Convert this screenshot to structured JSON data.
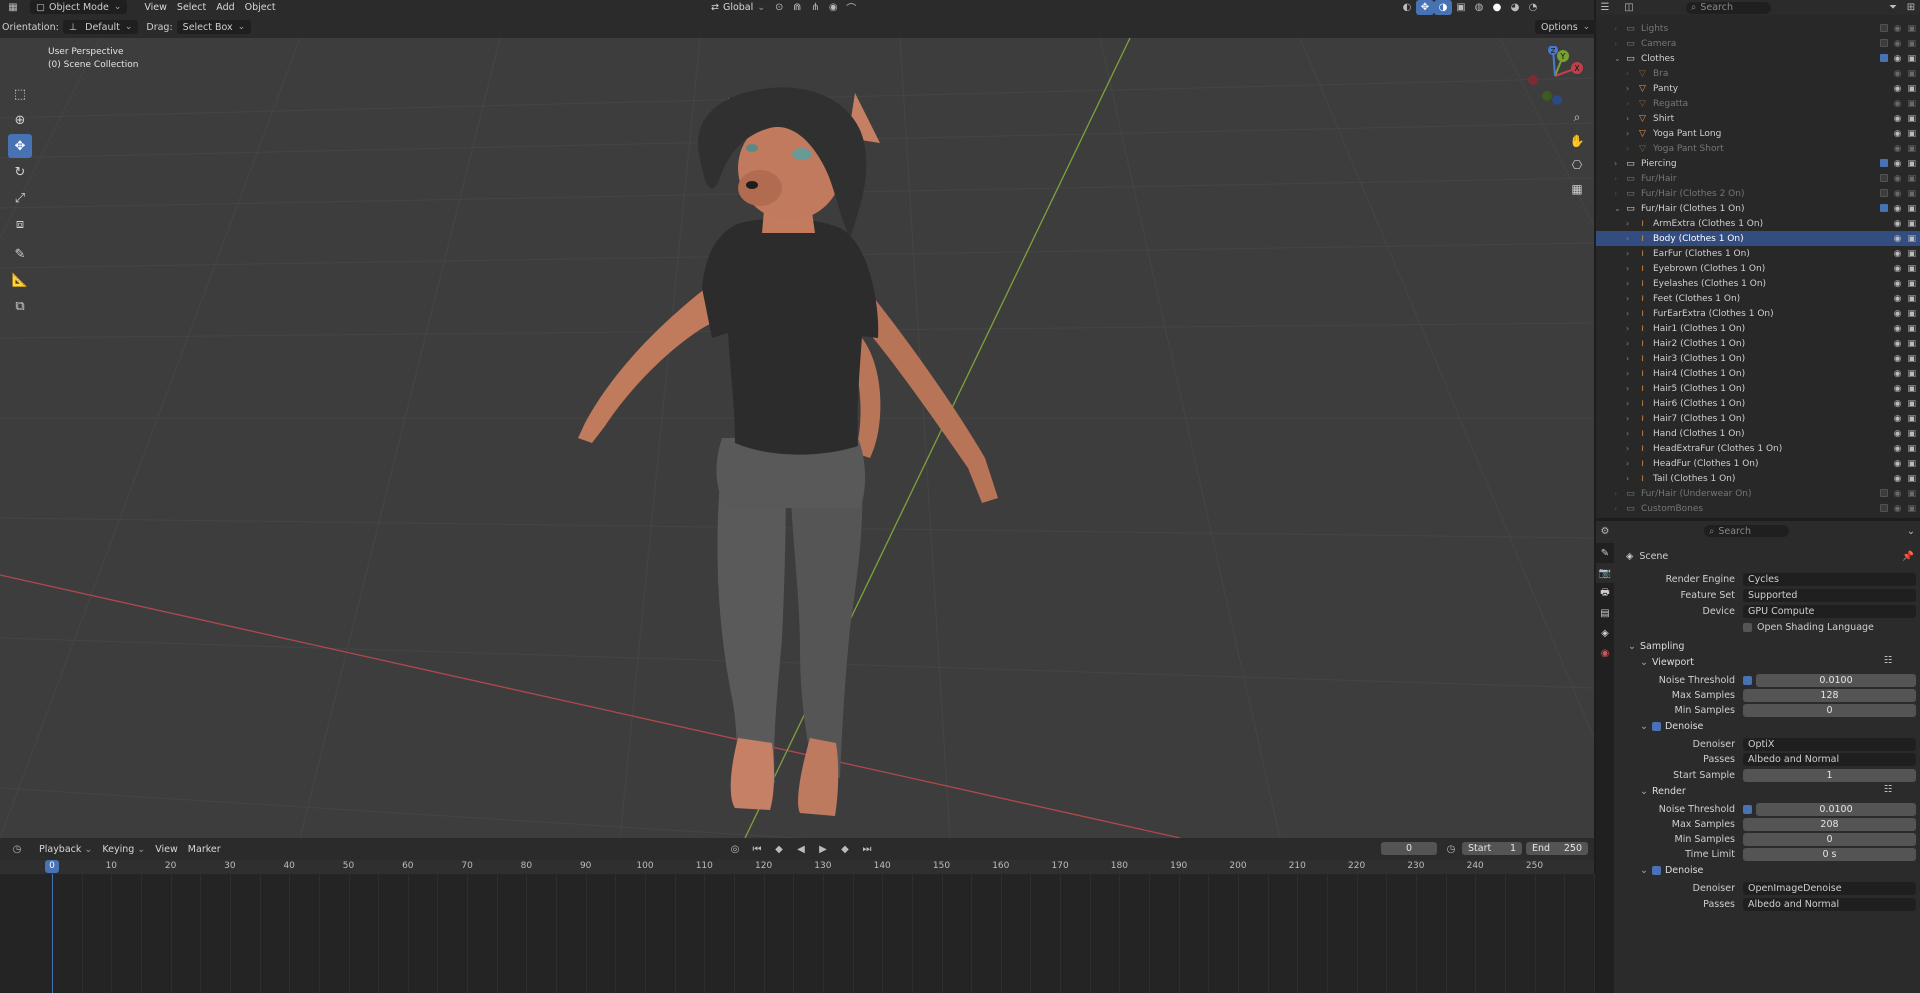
{
  "header": {
    "mode": "Object Mode",
    "menu": [
      "View",
      "Select",
      "Add",
      "Object"
    ],
    "transform_orientation": "Global",
    "orientation_label": "Orientation:",
    "orientation_value": "Default",
    "drag_label": "Drag:",
    "drag_value": "Select Box",
    "options_label": "Options",
    "search_placeholder": "Search"
  },
  "viewport": {
    "view_name": "User Perspective",
    "collection_info": "(0) Scene Collection",
    "gizmo": {
      "x": "X",
      "y": "Y",
      "z": "Z"
    }
  },
  "timeline": {
    "menu": [
      "Playback",
      "Keying",
      "View",
      "Marker"
    ],
    "current_frame": "0",
    "start_label": "Start",
    "start": "1",
    "end_label": "End",
    "end": "250",
    "playhead": "0",
    "ticks": [
      "10",
      "20",
      "30",
      "40",
      "50",
      "60",
      "70",
      "80",
      "90",
      "100",
      "110",
      "120",
      "130",
      "140",
      "150",
      "160",
      "170",
      "180",
      "190",
      "200",
      "210",
      "220",
      "230",
      "240",
      "250"
    ]
  },
  "outliner": {
    "search_placeholder": "Search",
    "items": [
      {
        "label": "Lights",
        "type": "collection",
        "level": 0,
        "dim": true
      },
      {
        "label": "Camera",
        "type": "collection",
        "level": 0,
        "dim": true
      },
      {
        "label": "Clothes",
        "type": "collection",
        "level": 0,
        "dim": false,
        "expanded": true
      },
      {
        "label": "Bra",
        "type": "mesh",
        "level": 1,
        "dim": true
      },
      {
        "label": "Panty",
        "type": "mesh",
        "level": 1,
        "dim": false
      },
      {
        "label": "Regatta",
        "type": "mesh",
        "level": 1,
        "dim": true
      },
      {
        "label": "Shirt",
        "type": "mesh",
        "level": 1,
        "dim": false
      },
      {
        "label": "Yoga Pant Long",
        "type": "mesh",
        "level": 1,
        "dim": false
      },
      {
        "label": "Yoga Pant Short",
        "type": "mesh",
        "level": 1,
        "dim": true
      },
      {
        "label": "Piercing",
        "type": "collection",
        "level": 0,
        "dim": false
      },
      {
        "label": "Fur/Hair",
        "type": "collection",
        "level": 0,
        "dim": true
      },
      {
        "label": "Fur/Hair (Clothes 2 On)",
        "type": "collection",
        "level": 0,
        "dim": true
      },
      {
        "label": "Fur/Hair (Clothes 1 On)",
        "type": "collection",
        "level": 0,
        "dim": false,
        "expanded": true
      },
      {
        "label": "ArmExtra (Clothes 1 On)",
        "type": "hair",
        "level": 1,
        "dim": false
      },
      {
        "label": "Body (Clothes 1 On)",
        "type": "hair",
        "level": 1,
        "dim": false,
        "selected": true
      },
      {
        "label": "EarFur (Clothes 1 On)",
        "type": "hair",
        "level": 1,
        "dim": false
      },
      {
        "label": "Eyebrown (Clothes 1 On)",
        "type": "hair",
        "level": 1,
        "dim": false
      },
      {
        "label": "Eyelashes (Clothes 1 On)",
        "type": "hair",
        "level": 1,
        "dim": false
      },
      {
        "label": "Feet (Clothes 1 On)",
        "type": "hair",
        "level": 1,
        "dim": false
      },
      {
        "label": "FurEarExtra (Clothes 1 On)",
        "type": "hair",
        "level": 1,
        "dim": false
      },
      {
        "label": "Hair1 (Clothes 1 On)",
        "type": "hair",
        "level": 1,
        "dim": false
      },
      {
        "label": "Hair2 (Clothes 1 On)",
        "type": "hair",
        "level": 1,
        "dim": false
      },
      {
        "label": "Hair3 (Clothes 1 On)",
        "type": "hair",
        "level": 1,
        "dim": false
      },
      {
        "label": "Hair4 (Clothes 1 On)",
        "type": "hair",
        "level": 1,
        "dim": false
      },
      {
        "label": "Hair5 (Clothes 1 On)",
        "type": "hair",
        "level": 1,
        "dim": false
      },
      {
        "label": "Hair6 (Clothes 1 On)",
        "type": "hair",
        "level": 1,
        "dim": false
      },
      {
        "label": "Hair7 (Clothes 1 On)",
        "type": "hair",
        "level": 1,
        "dim": false
      },
      {
        "label": "Hand (Clothes 1 On)",
        "type": "hair",
        "level": 1,
        "dim": false
      },
      {
        "label": "HeadExtraFur (Clothes 1 On)",
        "type": "hair",
        "level": 1,
        "dim": false
      },
      {
        "label": "HeadFur (Clothes 1 On)",
        "type": "hair",
        "level": 1,
        "dim": false
      },
      {
        "label": "Tail (Clothes 1 On)",
        "type": "hair",
        "level": 1,
        "dim": false
      },
      {
        "label": "Fur/Hair (Underwear On)",
        "type": "collection",
        "level": 0,
        "dim": true
      },
      {
        "label": "CustomBones",
        "type": "collection",
        "level": 0,
        "dim": true
      }
    ]
  },
  "properties": {
    "search_placeholder": "Search",
    "context": "Scene",
    "render_engine_label": "Render Engine",
    "render_engine": "Cycles",
    "feature_set_label": "Feature Set",
    "feature_set": "Supported",
    "device_label": "Device",
    "device": "GPU Compute",
    "osl_label": "Open Shading Language",
    "sampling": "Sampling",
    "viewport": "Viewport",
    "noise_threshold_label": "Noise Threshold",
    "vp_noise_threshold": "0.0100",
    "max_samples_label": "Max Samples",
    "vp_max_samples": "128",
    "min_samples_label": "Min Samples",
    "vp_min_samples": "0",
    "denoise": "Denoise",
    "denoiser_label": "Denoiser",
    "vp_denoiser": "OptiX",
    "passes_label": "Passes",
    "vp_passes": "Albedo and Normal",
    "start_sample_label": "Start Sample",
    "vp_start_sample": "1",
    "render": "Render",
    "r_noise_threshold": "0.0100",
    "r_max_samples": "208",
    "r_min_samples": "0",
    "time_limit_label": "Time Limit",
    "r_time_limit": "0 s",
    "r_denoiser": "OpenImageDenoise",
    "r_passes": "Albedo and Normal"
  },
  "colors": {
    "accent": "#4772b3",
    "x_axis": "#c0404a",
    "y_axis": "#7aa032",
    "fur": "#c27a5e",
    "shirt": "#2b2b2b",
    "pants": "#555555"
  }
}
